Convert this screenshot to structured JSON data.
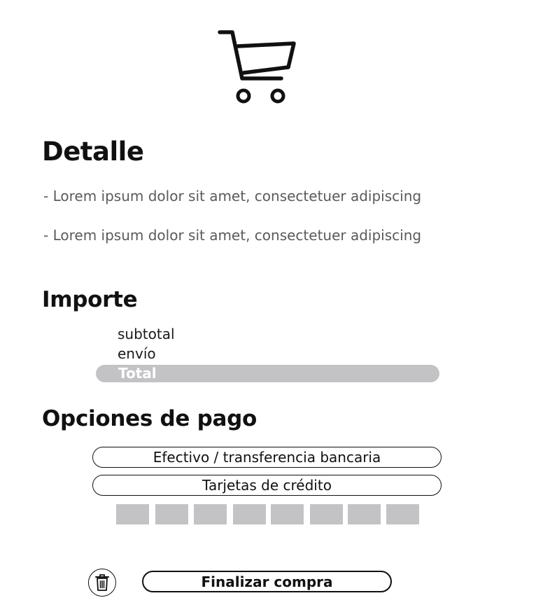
{
  "header": {
    "icon": "shopping-cart-icon"
  },
  "detalle": {
    "title": "Detalle",
    "items": [
      "- Lorem ipsum dolor sit amet, consectetuer adipiscing",
      "- Lorem ipsum dolor sit amet, consectetuer adipiscing"
    ]
  },
  "importe": {
    "title": "Importe",
    "subtotal_label": "subtotal",
    "envio_label": "envío",
    "total_label": "Total"
  },
  "pago": {
    "title": "Opciones de pago",
    "options": [
      "Efectivo / transferencia bancaria",
      "Tarjetas de crédito"
    ],
    "card_slot_count": 8
  },
  "footer": {
    "delete_icon": "trash-icon",
    "finish_label": "Finalizar compra"
  },
  "colors": {
    "text": "#111111",
    "muted_text": "#5a5a5a",
    "placeholder_gray": "#c3c3c6",
    "background": "#ffffff"
  }
}
